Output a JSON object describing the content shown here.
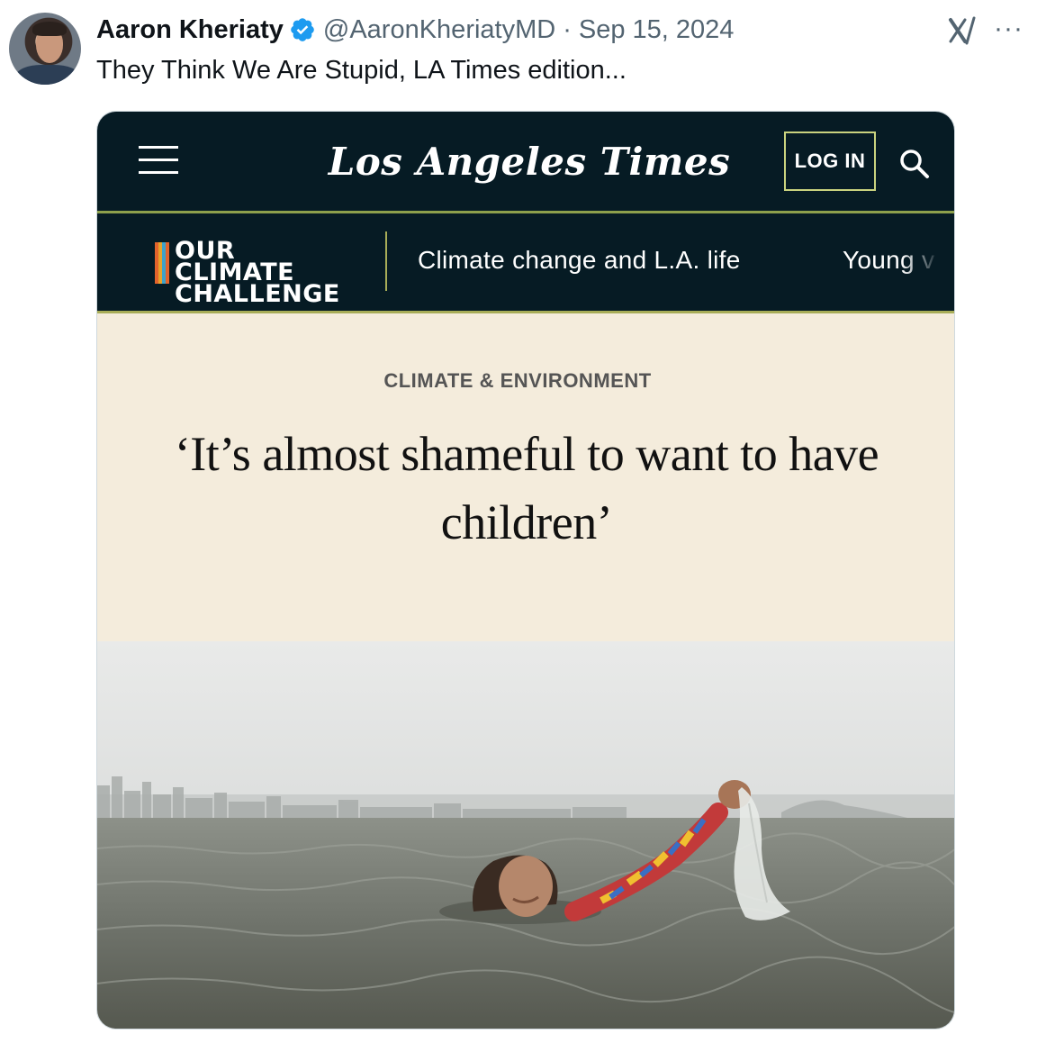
{
  "tweet": {
    "author_name": "Aaron Kheriaty",
    "handle": "@AaronKheriatyMD",
    "separator": "·",
    "date": "Sep 15, 2024",
    "text": "They Think We Are Stupid, LA Times edition...",
    "more_label": "···"
  },
  "lat": {
    "masthead": "Los Angeles Times",
    "login_label": "LOG IN",
    "climate_line1": "OUR CLIMATE",
    "climate_line2": "CHALLENGE",
    "subnav_link_1": "Climate change and L.A. life",
    "subnav_link_2": "Young v",
    "section": "CLIMATE & ENVIRONMENT",
    "headline": "‘It’s almost shameful to want to have children’"
  },
  "colors": {
    "verified": "#1d9bf0",
    "lat_navy": "#061b24",
    "lat_accent": "#a8ad58",
    "article_bg": "#f4ecdc"
  },
  "icons": [
    "verified-badge-icon",
    "x-logo-icon",
    "more-icon",
    "hamburger-icon",
    "search-icon"
  ]
}
